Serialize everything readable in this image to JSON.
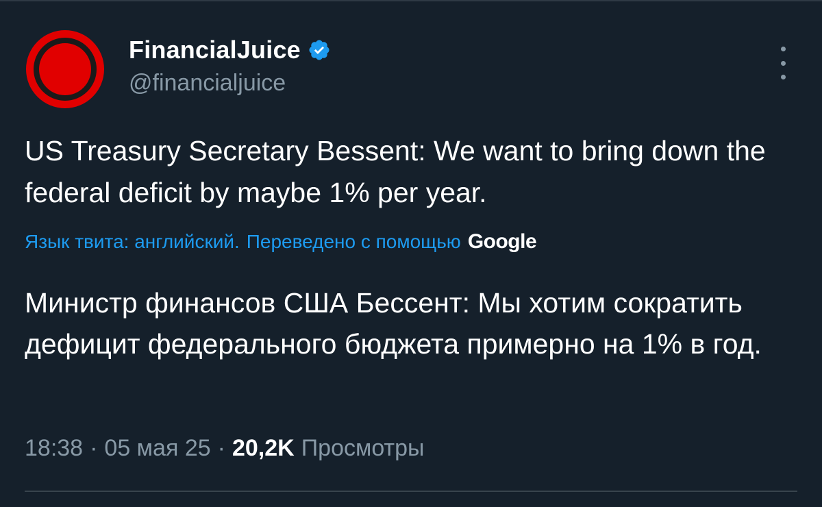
{
  "tweet": {
    "display_name": "FinancialJuice",
    "handle": "@financialjuice",
    "text": "US Treasury Secretary Bessent: We want to bring down the federal deficit by maybe 1% per year.",
    "translation_note": {
      "language_label": "Язык твита: английский.",
      "translated_label": "Переведено с помощью",
      "provider": "Google"
    },
    "translated_text": "Министр финансов США Бессент: Мы хотим сократить дефицит федерального бюджета примерно на 1% в год.",
    "meta": {
      "time": "18:38",
      "separator": "·",
      "date": "05 мая 25",
      "views_count": "20,2K",
      "views_label": "Просмотры"
    }
  },
  "icons": {
    "avatar": "financialjuice-logo",
    "verified": "verified-badge-icon",
    "more": "more-options-icon"
  },
  "colors": {
    "background": "#15202b",
    "link": "#1d9bf0",
    "secondary_text": "#8899a6",
    "avatar_red": "#e10000",
    "verified_blue": "#1d9bf0"
  }
}
